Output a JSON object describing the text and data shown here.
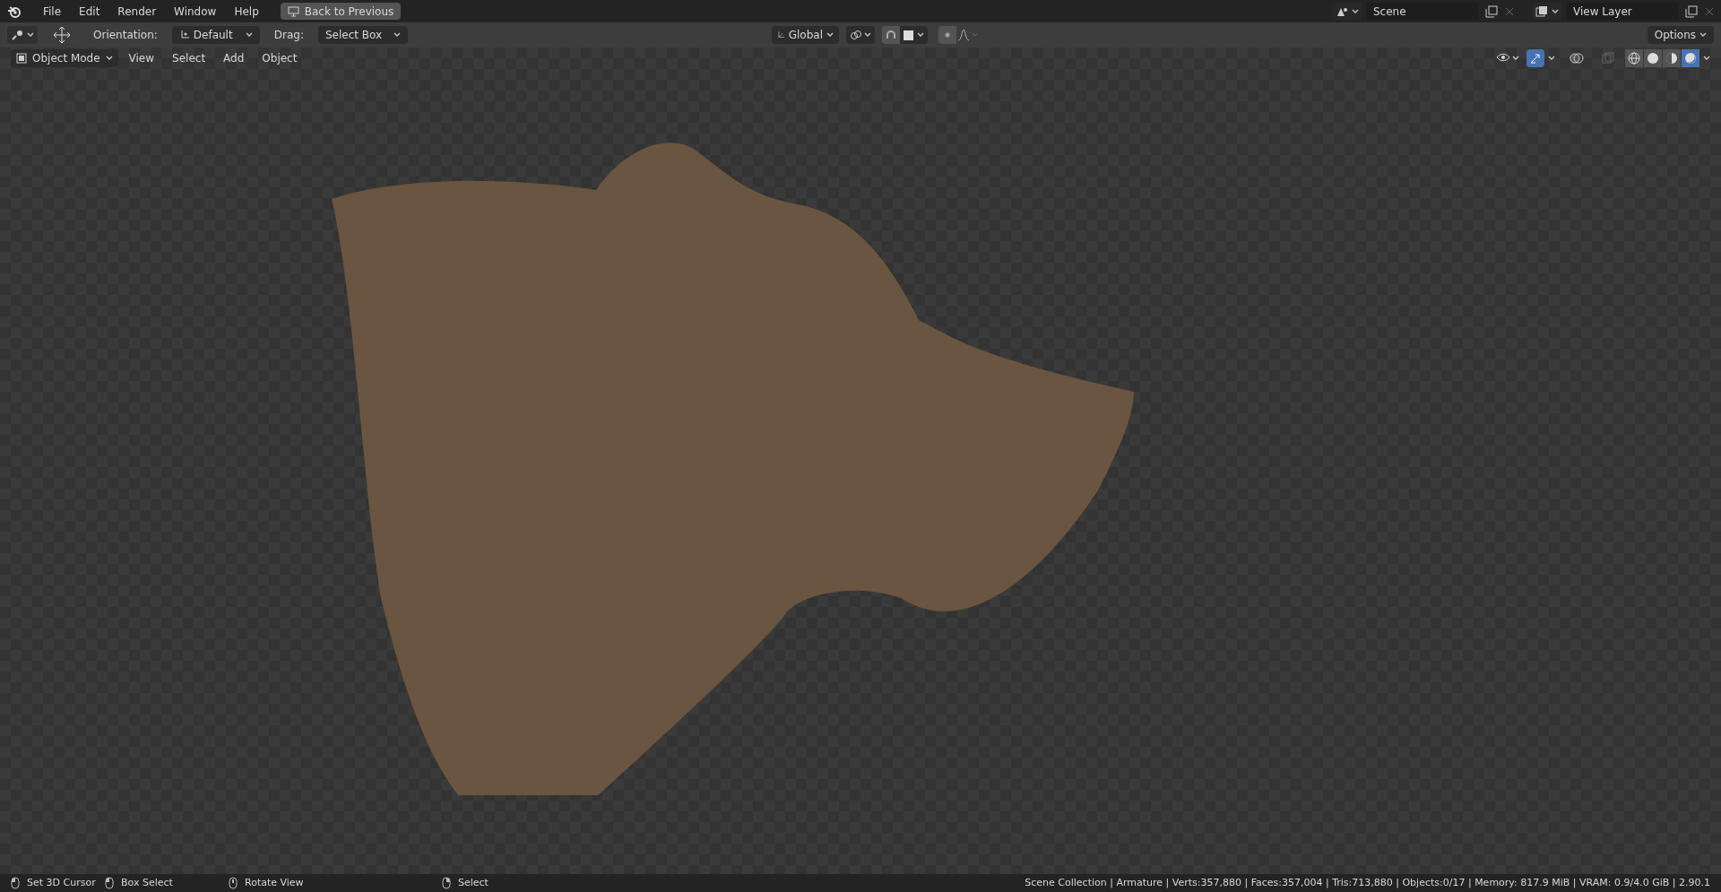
{
  "menu": [
    "File",
    "Edit",
    "Render",
    "Window",
    "Help"
  ],
  "back_button": {
    "label": "Back to Previous"
  },
  "scene": {
    "value": "Scene"
  },
  "view_layer": {
    "value": "View Layer"
  },
  "tool_header": {
    "orientation_label": "Orientation:",
    "orientation": "Default",
    "drag_label": "Drag:",
    "drag": "Select Box",
    "transform_space": "Global",
    "snap_on": false,
    "options": "Options"
  },
  "viewport_header": {
    "mode": "Object Mode",
    "menus": [
      "View",
      "Select",
      "Add",
      "Object"
    ],
    "gizmos_on": true,
    "shading": [
      {
        "kind": "wireframe",
        "selected": false
      },
      {
        "kind": "solid",
        "selected": false
      },
      {
        "kind": "material",
        "selected": false
      },
      {
        "kind": "rendered",
        "selected": true
      }
    ]
  },
  "status_bar": {
    "hints": [
      {
        "kind": "left",
        "label": "Set 3D Cursor"
      },
      {
        "kind": "drag",
        "label": "Box Select"
      },
      {
        "kind": "middle",
        "label": "Rotate View"
      },
      {
        "kind": "right",
        "label": "Select"
      }
    ],
    "stats": "Scene Collection | Armature | Verts:357,880 | Faces:357,004 | Tris:713,880 | Objects:0/17 | Memory: 817.9 MiB | VRAM: 0.9/4.0 GiB | 2.90.1"
  }
}
